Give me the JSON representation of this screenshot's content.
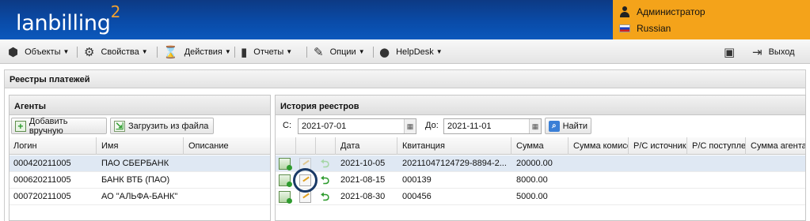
{
  "header": {
    "logo": "lanbilling",
    "logo_sup": "2",
    "user": "Администратор",
    "language": "Russian"
  },
  "menu": [
    {
      "label": "Объекты",
      "icon": "puzzle-icon"
    },
    {
      "label": "Свойства",
      "icon": "gear-icon"
    },
    {
      "label": "Действия",
      "icon": "hourglass-icon"
    },
    {
      "label": "Отчеты",
      "icon": "bar-chart-icon"
    },
    {
      "label": "Опции",
      "icon": "wrench-icon"
    },
    {
      "label": "HelpDesk",
      "icon": "chat-icon"
    }
  ],
  "logout": "Выход",
  "page_title": "Реестры платежей",
  "agents": {
    "title": "Агенты",
    "add_btn": "Добавить вручную",
    "load_btn": "Загрузить из файла",
    "columns": [
      "Логин",
      "Имя",
      "Описание"
    ],
    "rows": [
      {
        "login": "000420211005",
        "name": "ПАО СБЕРБАНК",
        "desc": ""
      },
      {
        "login": "000620211005",
        "name": "БАНК ВТБ (ПАО)",
        "desc": ""
      },
      {
        "login": "000720211005",
        "name": "АО \"АЛЬФА-БАНК\"",
        "desc": ""
      }
    ]
  },
  "history": {
    "title": "История реестров",
    "from_label": "С:",
    "from_value": "2021-07-01",
    "to_label": "До:",
    "to_value": "2021-11-01",
    "find_btn": "Найти",
    "columns": [
      "Дата",
      "Квитанция",
      "Сумма",
      "Сумма комиссии",
      "Р/С источника",
      "Р/С поступления",
      "Сумма агента"
    ],
    "rows": [
      {
        "date": "2021-10-05",
        "receipt": "20211047124729-8894-2...",
        "sum": "20000.00"
      },
      {
        "date": "2021-08-15",
        "receipt": "000139",
        "sum": "8000.00"
      },
      {
        "date": "2021-08-30",
        "receipt": "000456",
        "sum": "5000.00"
      }
    ]
  }
}
